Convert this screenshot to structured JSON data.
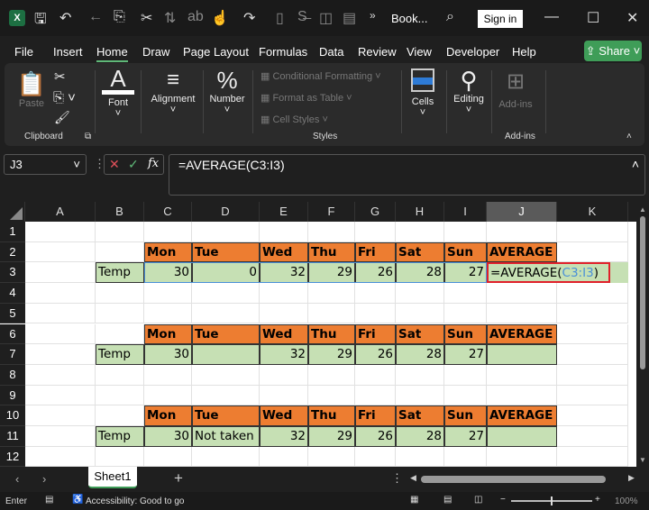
{
  "titlebar": {
    "doc_title": "Book...",
    "sign_in": "Sign in",
    "more": "»"
  },
  "menu": [
    "File",
    "Insert",
    "Home",
    "Draw",
    "Page Layout",
    "Formulas",
    "Data",
    "Review",
    "View",
    "Developer",
    "Help"
  ],
  "share": "Share",
  "ribbon": {
    "paste": "Paste",
    "clipboard": "Clipboard",
    "font": "Font",
    "alignment": "Alignment",
    "number": "Number",
    "conditional_formatting": "Conditional Formatting",
    "format_as_table": "Format as Table",
    "cell_styles": "Cell Styles",
    "styles": "Styles",
    "cells": "Cells",
    "editing": "Editing",
    "addins_btn": "Add-ins",
    "addins_group": "Add-ins"
  },
  "formula_bar": {
    "name_box": "J3",
    "formula": "=AVERAGE(C3:I3)",
    "fx": "fx"
  },
  "columns": [
    "A",
    "B",
    "C",
    "D",
    "E",
    "F",
    "G",
    "H",
    "I",
    "J",
    "K"
  ],
  "selected_column": "J",
  "rows": [
    "1",
    "2",
    "3",
    "4",
    "5",
    "6",
    "7",
    "8",
    "9",
    "10",
    "11",
    "12"
  ],
  "cells": {
    "2": {
      "C": "Mon",
      "D": "Tue",
      "E": "Wed",
      "F": "Thu",
      "G": "Fri",
      "H": "Sat",
      "I": "Sun",
      "J": "AVERAGE"
    },
    "3": {
      "B": "Temp",
      "C": "30",
      "D": "0",
      "E": "32",
      "F": "29",
      "G": "26",
      "H": "28",
      "I": "27"
    },
    "6": {
      "C": "Mon",
      "D": "Tue",
      "E": "Wed",
      "F": "Thu",
      "G": "Fri",
      "H": "Sat",
      "I": "Sun",
      "J": "AVERAGE"
    },
    "7": {
      "B": "Temp",
      "C": "30",
      "D": "",
      "E": "32",
      "F": "29",
      "G": "26",
      "H": "28",
      "I": "27",
      "J": ""
    },
    "10": {
      "C": "Mon",
      "D": "Tue",
      "E": "Wed",
      "F": "Thu",
      "G": "Fri",
      "H": "Sat",
      "I": "Sun",
      "J": "AVERAGE"
    },
    "11": {
      "B": "Temp",
      "C": "30",
      "D": "Not taken",
      "E": "32",
      "F": "29",
      "G": "26",
      "H": "28",
      "I": "27",
      "J": ""
    }
  },
  "editing_cell": {
    "prefix": "=AVERAGE(",
    "range": "C3:I3",
    "suffix": ")"
  },
  "colors": {
    "header_fill": "#ed7d31",
    "data_fill": "#c6e0b4",
    "highlight": "#e0202a",
    "range_ref": "#4a8fd8"
  },
  "sheet_tabs": [
    "Sheet1"
  ],
  "status": {
    "mode": "Enter",
    "accessibility": "Accessibility: Good to go",
    "zoom": "100%"
  }
}
